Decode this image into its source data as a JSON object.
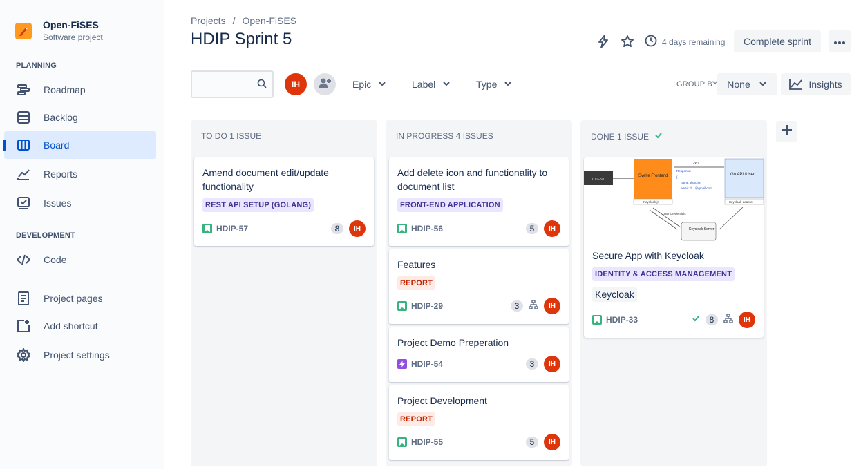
{
  "sidebar": {
    "project_name": "Open-FiSES",
    "project_type": "Software project",
    "planning_label": "PLANNING",
    "development_label": "DEVELOPMENT",
    "items": {
      "roadmap": "Roadmap",
      "backlog": "Backlog",
      "board": "Board",
      "reports": "Reports",
      "issues": "Issues",
      "code": "Code",
      "project_pages": "Project pages",
      "add_shortcut": "Add shortcut",
      "project_settings": "Project settings"
    }
  },
  "header": {
    "breadcrumb": [
      "Projects",
      "/",
      "Open-FiSES"
    ],
    "title": "HDIP Sprint 5",
    "remaining": "4 days remaining",
    "complete_sprint": "Complete sprint"
  },
  "toolbar": {
    "search_value": "",
    "user_initials": "IH",
    "filters": {
      "epic": "Epic",
      "label": "Label",
      "type": "Type"
    },
    "group_by_label": "GROUP BY",
    "group_by_value": "None",
    "insights": "Insights"
  },
  "columns": [
    {
      "header": "TO DO 1 ISSUE",
      "cards": [
        {
          "title": "Amend document edit/update functionality",
          "epic": "REST API SETUP (GOLANG)",
          "key": "HDIP-57",
          "points": "8",
          "assignee": "IH"
        }
      ]
    },
    {
      "header": "IN PROGRESS 4 ISSUES",
      "cards": [
        {
          "title": "Add delete icon and functionality to document list",
          "epic": "FRONT-END APPLICATION",
          "key": "HDIP-56",
          "points": "5",
          "assignee": "IH"
        },
        {
          "title": "Features",
          "epic": "REPORT",
          "key": "HDIP-29",
          "points": "3",
          "assignee": "IH"
        },
        {
          "title": "Project Demo Preperation",
          "key": "HDIP-54",
          "points": "3",
          "assignee": "IH"
        },
        {
          "title": "Project Development",
          "epic": "REPORT",
          "key": "HDIP-55",
          "points": "5",
          "assignee": "IH"
        }
      ]
    },
    {
      "header": "DONE 1 ISSUE",
      "cards": [
        {
          "title": "Secure App with Keycloak",
          "epic": "IDENTITY & ACCESS MANAGEMENT",
          "label": "Keycloak",
          "key": "HDIP-33",
          "points": "8",
          "assignee": "IH",
          "diagram": {
            "client": "CLIENT",
            "frontend": "Svelte Frontend",
            "keycloak_js": "Keycloak.js",
            "jwt": "JWT",
            "response": "Response:",
            "brace": "{",
            "name_line": "name: thutchin",
            "email_line": "email: th...@gmail.com",
            "go_api": "Go API /User",
            "adapter": "Keycloak-adapter",
            "user_credentials": "User Credentials",
            "keycloak_server": "Keycloak Server"
          }
        }
      ]
    }
  ],
  "colors": {
    "accent": "#0052cc",
    "avatar": "#de350b",
    "story": "#36b37e",
    "task": "#904ee2",
    "orange": "#ff991f"
  }
}
